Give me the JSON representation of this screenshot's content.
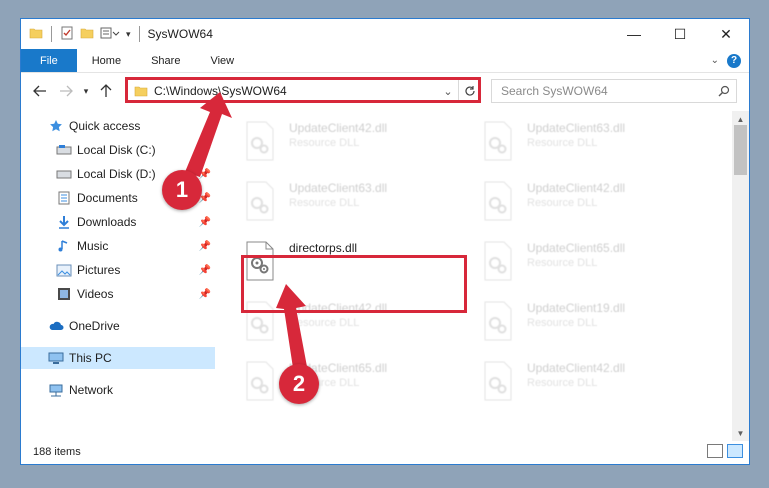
{
  "window": {
    "title": "SysWOW64",
    "controls": {
      "minimize": "—",
      "maximize": "☐",
      "close": "✕"
    }
  },
  "ribbon": {
    "tabs": [
      "File",
      "Home",
      "Share",
      "View"
    ],
    "help": "?"
  },
  "navigation": {
    "address": "C:\\Windows\\SysWOW64",
    "search_placeholder": "Search SysWOW64"
  },
  "navpane": {
    "quick_access": "Quick access",
    "items": [
      {
        "label": "Local Disk (C:)",
        "icon": "drive-icon"
      },
      {
        "label": "Local Disk (D:)",
        "icon": "drive-icon"
      },
      {
        "label": "Documents",
        "icon": "documents-icon"
      },
      {
        "label": "Downloads",
        "icon": "downloads-icon"
      },
      {
        "label": "Music",
        "icon": "music-icon"
      },
      {
        "label": "Pictures",
        "icon": "pictures-icon"
      },
      {
        "label": "Videos",
        "icon": "videos-icon"
      }
    ],
    "onedrive": "OneDrive",
    "this_pc": "This PC",
    "network": "Network"
  },
  "files": [
    {
      "name": "UpdateClient42.dll",
      "type": "Resource DLL",
      "faded": true
    },
    {
      "name": "UpdateClient63.dll",
      "type": "Resource DLL",
      "faded": true
    },
    {
      "name": "UpdateClient63.dll",
      "type": "Resource DLL",
      "faded": true
    },
    {
      "name": "UpdateClient42.dll",
      "type": "Resource DLL",
      "faded": true
    },
    {
      "name": "directorps.dll",
      "type": "",
      "faded": false
    },
    {
      "name": "UpdateClient65.dll",
      "type": "Resource DLL",
      "faded": true
    },
    {
      "name": "UpdateClient42.dll",
      "type": "Resource DLL",
      "faded": true
    },
    {
      "name": "UpdateClient19.dll",
      "type": "Resource DLL",
      "faded": true
    },
    {
      "name": "UpdateClient65.dll",
      "type": "Resource DLL",
      "faded": true
    },
    {
      "name": "UpdateClient42.dll",
      "type": "Resource DLL",
      "faded": true
    }
  ],
  "status": {
    "item_count": "188 items"
  },
  "annotations": {
    "step1": "1",
    "step2": "2"
  },
  "colors": {
    "accent": "#1979ca",
    "annotation": "#d7283a",
    "selected": "#cce8ff"
  }
}
